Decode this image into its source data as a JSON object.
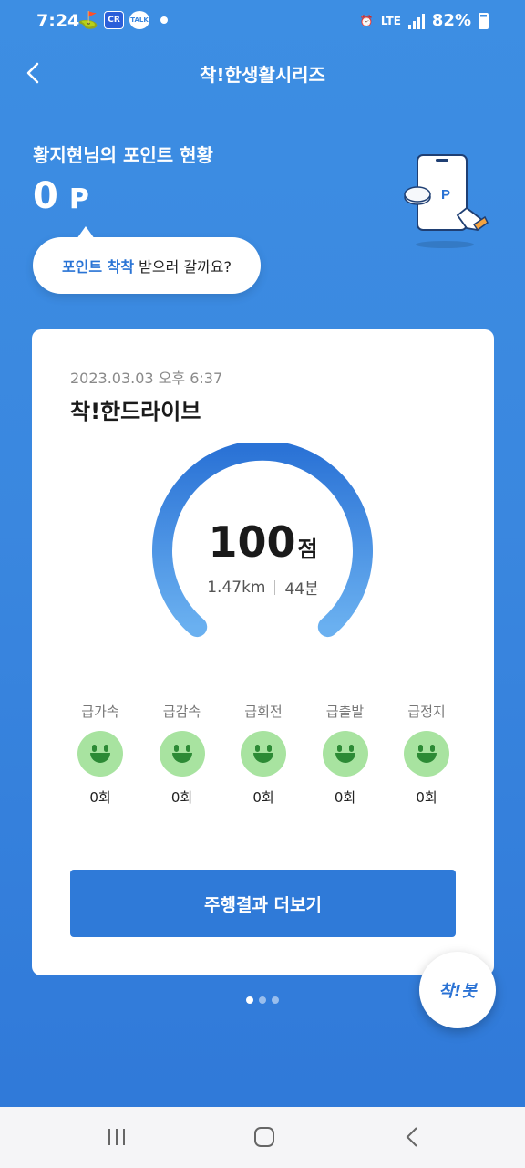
{
  "status_bar": {
    "time": "7:24",
    "icons": [
      "golf-icon",
      "shop-icon",
      "kakaotalk-icon",
      "dot-icon"
    ],
    "network": "LTE",
    "battery": "82%"
  },
  "header": {
    "title": "착!한생활시리즈"
  },
  "points": {
    "owner_label": "황지현님의 포인트 현황",
    "value": "0",
    "unit": "P"
  },
  "speech_bubble": {
    "highlight": "포인트 착착",
    "text": "받으러 갈까요?"
  },
  "card": {
    "date": "2023.03.03 오후 6:37",
    "title": "착!한드라이브",
    "score": "100",
    "score_unit": "점",
    "distance": "1.47km",
    "duration": "44분",
    "events": [
      {
        "label": "급가속",
        "count": "0회"
      },
      {
        "label": "급감속",
        "count": "0회"
      },
      {
        "label": "급회전",
        "count": "0회"
      },
      {
        "label": "급출발",
        "count": "0회"
      },
      {
        "label": "급정지",
        "count": "0회"
      }
    ],
    "more_button": "주행결과 더보기"
  },
  "pager": {
    "count": 3,
    "active": 0
  },
  "fab": {
    "label": "착!봇"
  },
  "colors": {
    "background": "#3a87df",
    "accent": "#2f7ad8",
    "smile": "#a8e3a0"
  }
}
